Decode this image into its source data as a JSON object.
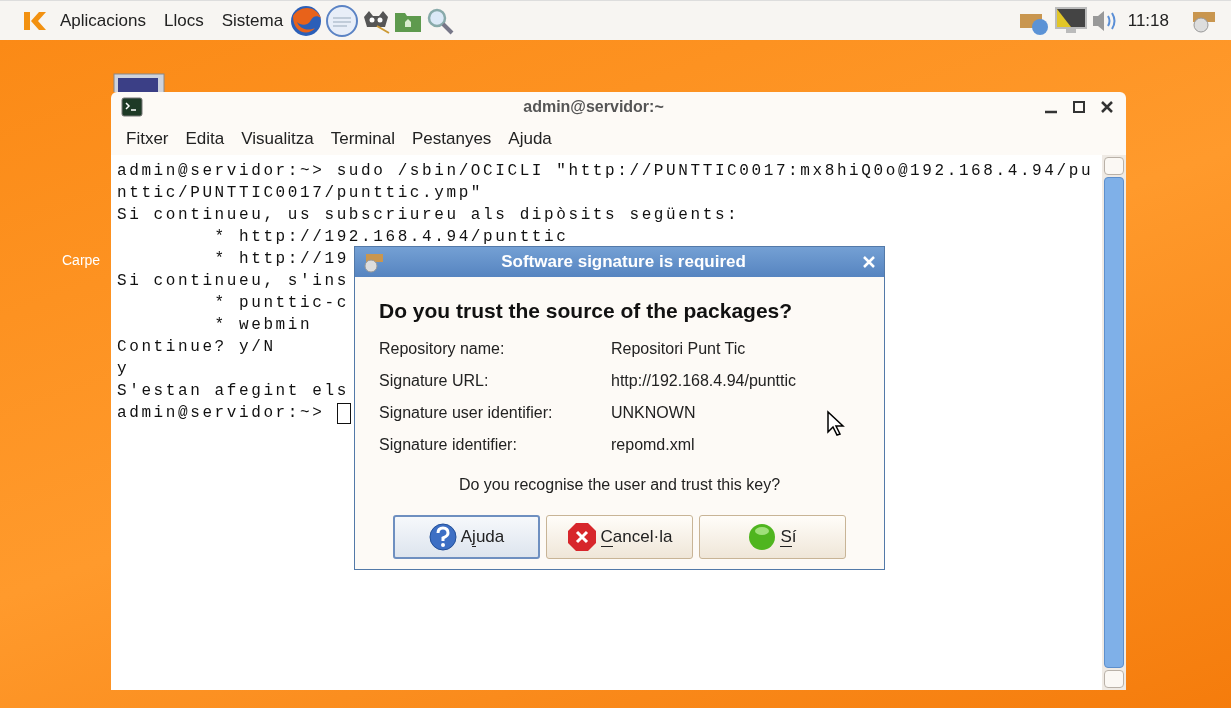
{
  "top_panel": {
    "menus": [
      "Aplicacions",
      "Llocs",
      "Sistema"
    ],
    "clock": "11:18"
  },
  "desktop": {
    "icon_label": "Carpe"
  },
  "terminal": {
    "title": "admin@servidor:~",
    "menu": [
      "Fitxer",
      "Edita",
      "Visualitza",
      "Terminal",
      "Pestanyes",
      "Ajuda"
    ],
    "lines": [
      "admin@servidor:~> sudo /sbin/OCICLI \"http://PUNTTIC0017:mx8hiQ0o@192.168.4.94/pu",
      "nttic/PUNTTIC0017/punttic.ymp\"",
      "Si continueu, us subscriureu als dipòsits següents:",
      "        * http://192.168.4.94/punttic",
      "        * http://19",
      "Si continueu, s'ins",
      "        * punttic-c",
      "        * webmin",
      "Continue? y/N",
      "y",
      "S'estan afegint els",
      "admin@servidor:~> "
    ],
    "cursor": true
  },
  "dialog": {
    "title": "Software signature is required",
    "heading": "Do you trust the source of the packages?",
    "fields": [
      {
        "label": "Repository name:",
        "value": "Repositori Punt Tic"
      },
      {
        "label": "Signature URL:",
        "value": "http://192.168.4.94/punttic"
      },
      {
        "label": "Signature user identifier:",
        "value": "UNKNOWN"
      },
      {
        "label": "Signature identifier:",
        "value": "repomd.xml"
      }
    ],
    "question": "Do you recognise the user and trust this key?",
    "buttons": [
      {
        "kind": "help",
        "label_parts": [
          {
            "text": "A",
            "underlined": false
          },
          {
            "text": "j",
            "underlined": true
          },
          {
            "text": "uda",
            "underlined": false
          }
        ],
        "focused": true
      },
      {
        "kind": "cancel",
        "label_parts": [
          {
            "text": "C",
            "underlined": true
          },
          {
            "text": "ancel·la",
            "underlined": false
          }
        ],
        "focused": false
      },
      {
        "kind": "ok",
        "label_parts": [
          {
            "text": "S",
            "underlined": true
          },
          {
            "text": "í",
            "underlined": false
          }
        ],
        "focused": false
      }
    ]
  }
}
